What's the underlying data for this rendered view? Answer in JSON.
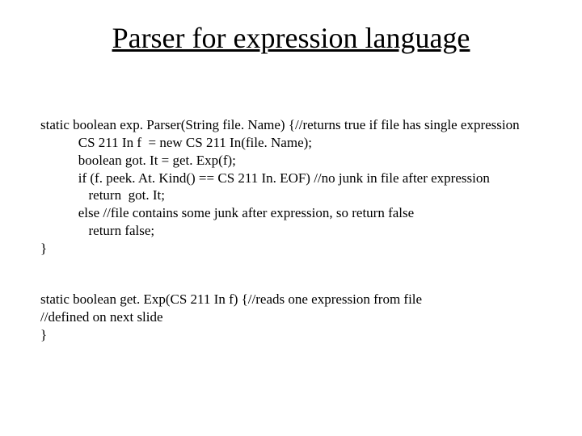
{
  "title": "Parser for expression language",
  "code1": {
    "l0": "static boolean exp. Parser(String file. Name) {//returns true if file has single expression",
    "l1": "           CS 211 In f  = new CS 211 In(file. Name);",
    "l2": "           boolean got. It = get. Exp(f);",
    "l3": "           if (f. peek. At. Kind() == CS 211 In. EOF) //no junk in file after expression",
    "l4": "              return  got. It;",
    "l5": "           else //file contains some junk after expression, so return false",
    "l6": "              return false;",
    "l7": "}"
  },
  "code2": {
    "l0": "static boolean get. Exp(CS 211 In f) {//reads one expression from file",
    "l1": "//defined on next slide",
    "l2": "}"
  }
}
